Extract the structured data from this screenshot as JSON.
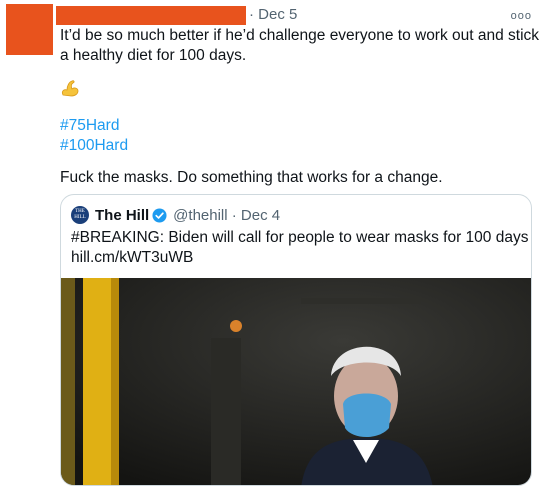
{
  "tweet": {
    "meta": "· Dec 5",
    "more": "ooo",
    "text_line1": "It’d be so much better if he’d challenge everyone to work out and stick to",
    "text_line2": "a healthy diet for 100 days.",
    "emoji": "flexed-biceps",
    "hashtags": [
      "#75Hard",
      "#100Hard"
    ],
    "closing": "Fuck the masks. Do something that works for a change."
  },
  "quote": {
    "logo_line1": "THE",
    "logo_line2": "HILL",
    "name": "The Hill",
    "handle": "@thehill · Dec 4",
    "text_line1": "#BREAKING: Biden will call for people to wear masks for 100 days",
    "link": "hill.cm/kWT3uWB"
  },
  "colors": {
    "redaction": "#e8531d",
    "link": "#1d9bf0",
    "verified": "#1d9bf0"
  }
}
